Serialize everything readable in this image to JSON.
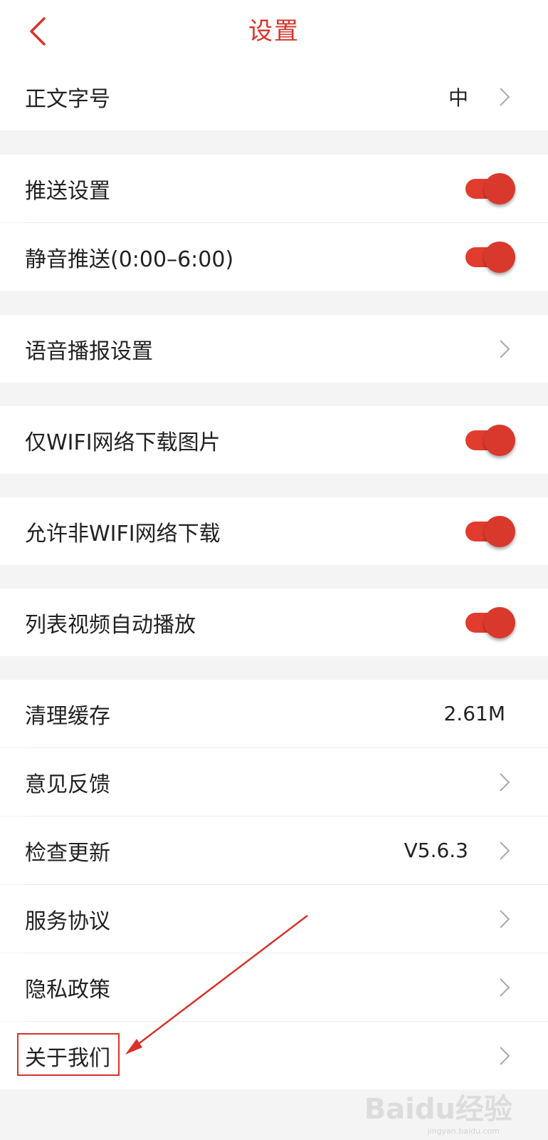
{
  "header": {
    "title": "设置",
    "back_icon": "chevron-left-icon"
  },
  "colors": {
    "accent": "#d5342b",
    "toggle_on": "#e23c2f",
    "background": "#f4f4f4",
    "row_bg": "#ffffff",
    "annotation": "#d8322a"
  },
  "settings": {
    "font_size": {
      "label": "正文字号",
      "value": "中"
    },
    "push": {
      "label": "推送设置",
      "enabled": true
    },
    "silent_push": {
      "label": "静音推送(0:00–6:00)",
      "enabled": true
    },
    "voice_broadcast": {
      "label": "语音播报设置"
    },
    "wifi_images": {
      "label": "仅WIFI网络下载图片",
      "enabled": true
    },
    "non_wifi_download": {
      "label": "允许非WIFI网络下载",
      "enabled": true
    },
    "autoplay_video": {
      "label": "列表视频自动播放",
      "enabled": true
    },
    "clear_cache": {
      "label": "清理缓存",
      "value": "2.61M"
    },
    "feedback": {
      "label": "意见反馈"
    },
    "check_update": {
      "label": "检查更新",
      "value": "V5.6.3"
    },
    "service_agreement": {
      "label": "服务协议"
    },
    "privacy_policy": {
      "label": "隐私政策"
    },
    "about_us": {
      "label": "关于我们"
    }
  },
  "watermark": {
    "logo_text": "Baidu经验",
    "url_text": "jingyan.baidu.com"
  }
}
